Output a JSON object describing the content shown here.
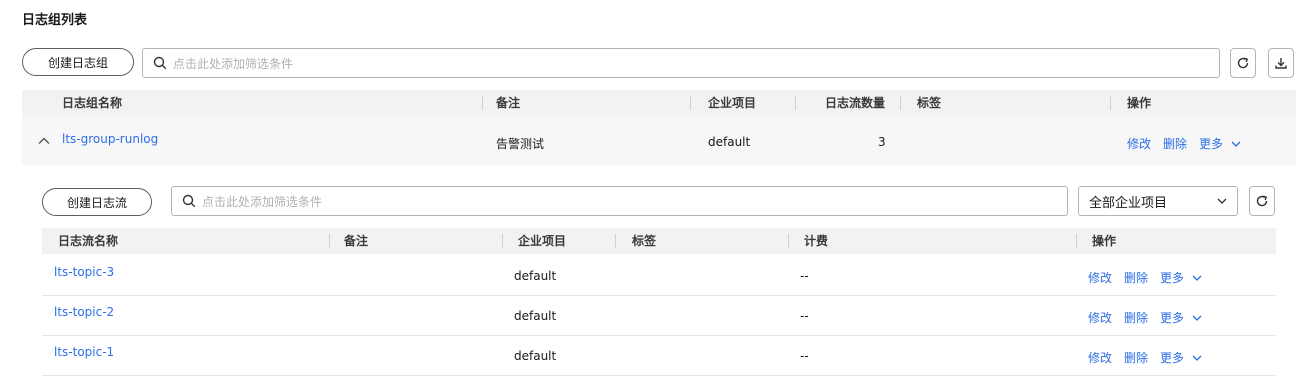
{
  "page_title": "日志组列表",
  "group_toolbar": {
    "create_label": "创建日志组",
    "search_placeholder": "点击此处添加筛选条件",
    "refresh_icon": "refresh-icon",
    "download_icon": "download-icon"
  },
  "group_table": {
    "headers": [
      "日志组名称",
      "备注",
      "企业项目",
      "日志流数量",
      "标签",
      "操作"
    ],
    "rows": [
      {
        "name": "lts-group-runlog",
        "remark": "告警测试",
        "enterprise_project": "default",
        "stream_count": "3",
        "tags": "",
        "actions": {
          "modify": "修改",
          "delete": "删除",
          "more": "更多"
        }
      }
    ]
  },
  "stream_toolbar": {
    "create_label": "创建日志流",
    "search_placeholder": "点击此处添加筛选条件",
    "enterprise_select_value": "全部企业项目"
  },
  "stream_table": {
    "headers": [
      "日志流名称",
      "备注",
      "企业项目",
      "标签",
      "计费",
      "操作"
    ],
    "rows": [
      {
        "name": "lts-topic-3",
        "remark": "",
        "enterprise_project": "default",
        "tags": "",
        "billing": "--",
        "actions": {
          "modify": "修改",
          "delete": "删除",
          "more": "更多"
        }
      },
      {
        "name": "lts-topic-2",
        "remark": "",
        "enterprise_project": "default",
        "tags": "",
        "billing": "--",
        "actions": {
          "modify": "修改",
          "delete": "删除",
          "more": "更多"
        }
      },
      {
        "name": "lts-topic-1",
        "remark": "",
        "enterprise_project": "default",
        "tags": "",
        "billing": "--",
        "actions": {
          "modify": "修改",
          "delete": "删除",
          "more": "更多"
        }
      }
    ]
  },
  "colors": {
    "link": "#2a6ee8",
    "header_bg": "#f2f2f2",
    "expanded_row_bg": "#f7f7f7"
  }
}
